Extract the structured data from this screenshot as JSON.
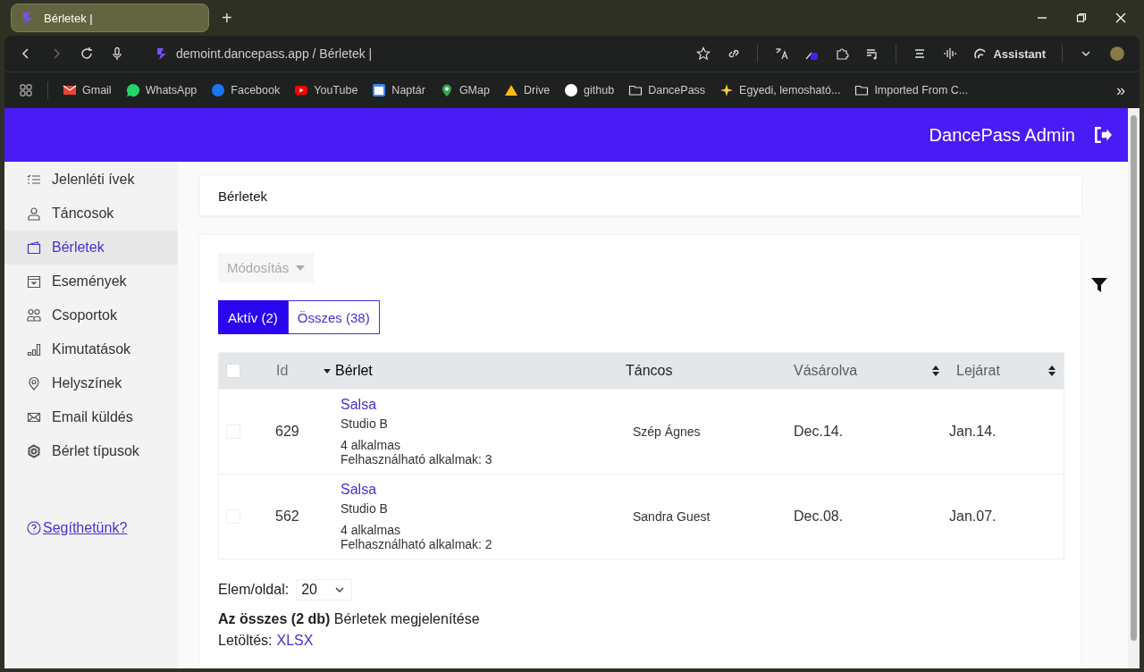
{
  "browser": {
    "tab": {
      "title": "Bérletek |",
      "selected": true
    },
    "new_tab": "+",
    "address": "demoint.dancepass.app / Bérletek |",
    "assistant": "Assistant",
    "bookmarks": [
      {
        "kind": "gmail",
        "label": "Gmail"
      },
      {
        "kind": "whatsapp",
        "label": "WhatsApp"
      },
      {
        "kind": "facebook",
        "label": "Facebook"
      },
      {
        "kind": "youtube",
        "label": "YouTube"
      },
      {
        "kind": "calendar",
        "label": "Naptár"
      },
      {
        "kind": "map",
        "label": "GMap"
      },
      {
        "kind": "drive",
        "label": "Drive"
      },
      {
        "kind": "github",
        "label": "github"
      },
      {
        "kind": "folder",
        "label": "DancePass"
      },
      {
        "kind": "sparkle",
        "label": "Egyedi, lemosható..."
      },
      {
        "kind": "folder",
        "label": "Imported From C..."
      }
    ],
    "more": "»"
  },
  "app": {
    "title": "DancePass Admin",
    "sidebar": {
      "items": [
        {
          "kind": "list",
          "label": "Jelenléti ívek",
          "selected": false
        },
        {
          "kind": "person",
          "label": "Táncosok",
          "selected": false
        },
        {
          "kind": "pass",
          "label": "Bérletek",
          "selected": true
        },
        {
          "kind": "calendar",
          "label": "Események",
          "selected": false
        },
        {
          "kind": "people",
          "label": "Csoportok",
          "selected": false
        },
        {
          "kind": "chart",
          "label": "Kimutatások",
          "selected": false
        },
        {
          "kind": "pin",
          "label": "Helyszínek",
          "selected": false
        },
        {
          "kind": "mail",
          "label": "Email küldés",
          "selected": false
        },
        {
          "kind": "gear",
          "label": "Bérlet típusok",
          "selected": false
        }
      ],
      "help": "Segíthetünk?"
    },
    "page_title": "Bérletek",
    "actions": {
      "label": "Módosítás",
      "disabled": true
    },
    "tabs": [
      {
        "label": "Aktív (2)",
        "selected": true
      },
      {
        "label": "Összes (38)",
        "selected": false
      }
    ],
    "table": {
      "columns": [
        {
          "kind": "check",
          "checked": false
        },
        {
          "kind": "id",
          "label": "Id",
          "sortable": false,
          "sorted_descending": false
        },
        {
          "kind": "pass",
          "label": "Bérlet",
          "sortable": true,
          "sorted_descending": true
        },
        {
          "kind": "dancer",
          "label": "Táncos",
          "sortable": false,
          "sorted_descending": false
        },
        {
          "kind": "bought",
          "label": "Vásárolva",
          "sortable": true,
          "sorted_descending": false
        },
        {
          "kind": "expires",
          "label": "Lejárat",
          "sortable": true,
          "sorted_descending": false
        }
      ],
      "rows": [
        {
          "checked": false,
          "id": "629",
          "pass": "Salsa",
          "studio": "Studio B",
          "occasions": "4 alkalmas",
          "usable": "Felhasználható alkalmak: 3",
          "dancer": "Szép Ágnes",
          "bought": "Dec.14.",
          "expires": "Jan.14."
        },
        {
          "checked": false,
          "id": "562",
          "pass": "Salsa",
          "studio": "Studio B",
          "occasions": "4 alkalmas",
          "usable": "Felhasználható alkalmak: 2",
          "dancer": "Sandra Guest",
          "bought": "Dec.08.",
          "expires": "Jan.07."
        }
      ]
    },
    "per_page": {
      "label": "Elem/oldal:",
      "value": "20"
    },
    "summary": "**Az összes (2 db)** Bérletek megjelenítése",
    "download": {
      "label": "Letöltés:",
      "link": "XLSX"
    }
  }
}
